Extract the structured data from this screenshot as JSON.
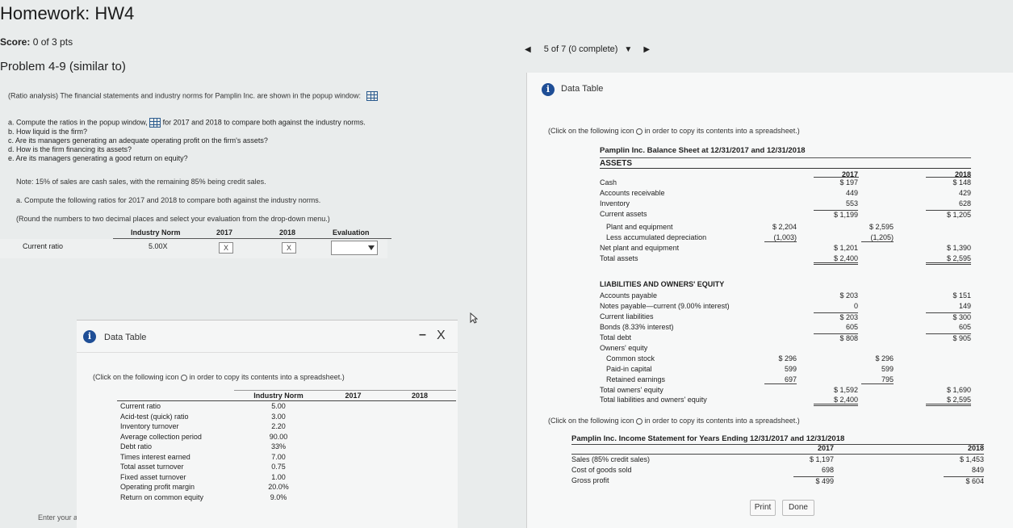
{
  "header": {
    "title": "Homework: HW4",
    "score_label": "Score:",
    "score_value": "0 of 3 pts",
    "problem": "Problem 4-9 (similar to)",
    "pager": "5 of 7 (0 complete)"
  },
  "question": {
    "intro": "(Ratio analysis) The financial statements and industry norms for Pamplin Inc. are shown in the popup window:",
    "qa": "a. Compute the ratios in the popup window,",
    "qa_tail": "for 2017 and 2018 to compare both against the industry norms.",
    "qb": "b. How liquid is the firm?",
    "qc": "c. Are its managers generating an adequate operating profit on the firm's assets?",
    "qd": "d. How is the firm financing its assets?",
    "qe": "e. Are its managers generating a good return on equity?",
    "note": "Note: 15% of sales are cash sales, with the remaining 85% being credit sales.",
    "part_a": "a. Compute the following ratios for 2017 and 2018 to compare both against the industry norms.",
    "round": "(Round the numbers to two decimal places and select your evaluation from the drop-down menu.)",
    "col_norm": "Industry Norm",
    "col_2017": "2017",
    "col_2018": "2018",
    "col_eval": "Evaluation",
    "row_label": "Current ratio",
    "row_norm": "5.00X",
    "x_mark": "X",
    "enter": "Enter your a"
  },
  "popup_left": {
    "title": "Data Table",
    "minimize": "–",
    "close": "X",
    "click_note_a": "(Click on the following icon",
    "click_note_b": "in order to copy its contents into a spreadsheet.)",
    "headers": [
      "",
      "Industry Norm",
      "2017",
      "2018"
    ],
    "rows": [
      [
        "Current ratio",
        "5.00",
        "",
        ""
      ],
      [
        "Acid-test (quick) ratio",
        "3.00",
        "",
        ""
      ],
      [
        "Inventory turnover",
        "2.20",
        "",
        ""
      ],
      [
        "Average collection period",
        "90.00",
        "",
        ""
      ],
      [
        "Debt ratio",
        "33%",
        "",
        ""
      ],
      [
        "Times interest earned",
        "7.00",
        "",
        ""
      ],
      [
        "Total asset turnover",
        "0.75",
        "",
        ""
      ],
      [
        "Fixed asset turnover",
        "1.00",
        "",
        ""
      ],
      [
        "Operating profit margin",
        "20.0%",
        "",
        ""
      ],
      [
        "Return on common equity",
        "9.0%",
        "",
        ""
      ]
    ]
  },
  "popup_right": {
    "title": "Data Table",
    "click_note_a": "(Click on the following icon",
    "click_note_b": "in order to copy its contents into a spreadsheet.)",
    "bs_title": "Pamplin Inc. Balance Sheet at 12/31/2017 and 12/31/2018",
    "assets": "ASSETS",
    "y2017": "2017",
    "y2018": "2018",
    "cash": [
      "Cash",
      "$  197",
      "$  148"
    ],
    "ar": [
      "Accounts receivable",
      "449",
      "429"
    ],
    "inv": [
      "Inventory",
      "553",
      "628"
    ],
    "ca": [
      "Current assets",
      "$ 1,199",
      "$ 1,205"
    ],
    "pe": [
      "Plant and equipment",
      "$ 2,204",
      "$ 2,595"
    ],
    "dep": [
      "Less accumulated depreciation",
      "(1,003)",
      "(1,205)"
    ],
    "npe": [
      "Net plant and equipment",
      "$ 1,201",
      "$ 1,390"
    ],
    "ta": [
      "Total assets",
      "$ 2,400",
      "$ 2,595"
    ],
    "liab_title": "LIABILITIES AND OWNERS' EQUITY",
    "ap": [
      "Accounts payable",
      "$  203",
      "$  151"
    ],
    "np": [
      "Notes payable—current (9.00% interest)",
      "0",
      "149"
    ],
    "cl": [
      "Current liabilities",
      "$  203",
      "$  300"
    ],
    "bonds": [
      "Bonds (8.33% interest)",
      "605",
      "605"
    ],
    "td": [
      "Total debt",
      "$  808",
      "$  905"
    ],
    "oe": "Owners' equity",
    "cs": [
      "Common stock",
      "$  296",
      "$  296"
    ],
    "pic": [
      "Paid-in capital",
      "599",
      "599"
    ],
    "re": [
      "Retained earnings",
      "697",
      "795"
    ],
    "toe": [
      "Total owners' equity",
      "$ 1,592",
      "$ 1,690"
    ],
    "tloe": [
      "Total liabilities and owners' equity",
      "$ 2,400",
      "$ 2,595"
    ],
    "is_note_a": "(Click on the following icon",
    "is_note_b": "in order to copy its contents into a spreadsheet.)",
    "is_title": "Pamplin Inc. Income Statement for Years Ending 12/31/2017 and 12/31/2018",
    "sales": [
      "Sales (85% credit sales)",
      "$ 1,197",
      "$ 1,453"
    ],
    "cogs": [
      "Cost of goods sold",
      "698",
      "849"
    ],
    "gp": [
      "Gross profit",
      "$  499",
      "$  604"
    ],
    "print": "Print",
    "done": "Done"
  }
}
